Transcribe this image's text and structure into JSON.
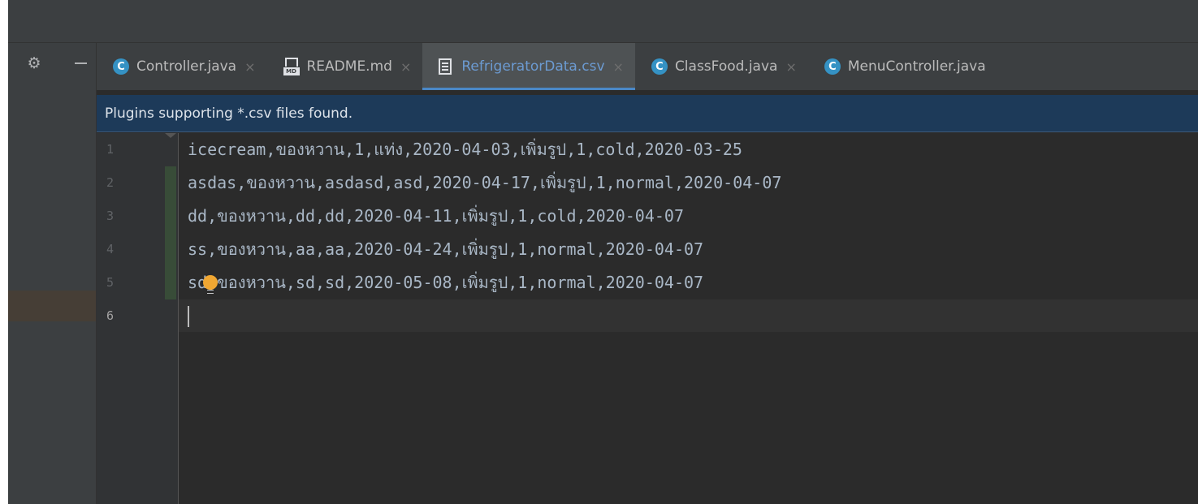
{
  "toolbar": {
    "settings_icon": "gear-icon",
    "minimize_icon": "minimize-icon"
  },
  "tabs": [
    {
      "label": "Controller.java",
      "icon": "java-class-icon",
      "icon_letter": "C",
      "active": false
    },
    {
      "label": "README.md",
      "icon": "markdown-file-icon",
      "icon_letter": "MD",
      "active": false
    },
    {
      "label": "RefrigeratorData.csv",
      "icon": "text-file-icon",
      "active": true
    },
    {
      "label": "ClassFood.java",
      "icon": "java-class-icon",
      "icon_letter": "C",
      "active": false
    },
    {
      "label": "MenuController.java",
      "icon": "java-class-icon",
      "icon_letter": "C",
      "active": false
    }
  ],
  "tab_close_glyph": "×",
  "banner": {
    "text": "Plugins supporting *.csv files found."
  },
  "editor": {
    "line_numbers": [
      "1",
      "2",
      "3",
      "4",
      "5",
      "6"
    ],
    "lines": [
      "icecream,ของหวาน,1,แท่ง,2020-04-03,เพิ่มรูป,1,cold,2020-03-25",
      "asdas,ของหวาน,asdasd,asd,2020-04-17,เพิ่มรูป,1,normal,2020-04-07",
      "dd,ของหวาน,dd,dd,2020-04-11,เพิ่มรูป,1,cold,2020-04-07",
      "ss,ของหวาน,aa,aa,2020-04-24,เพิ่มรูป,1,normal,2020-04-07",
      "sd,ของหวาน,sd,sd,2020-05-08,เพิ่มรูป,1,normal,2020-04-07",
      ""
    ],
    "current_line": "6"
  },
  "colors": {
    "background": "#2b2b2b",
    "tab_bar": "#3c3f41",
    "active_tab_text": "#6c9bd2",
    "active_tab_underline": "#4a88c7",
    "banner_bg": "#1d3a59",
    "code_text": "#a9b7c6",
    "changed_line_marker": "#384c38",
    "bulb": "#f0a732"
  }
}
